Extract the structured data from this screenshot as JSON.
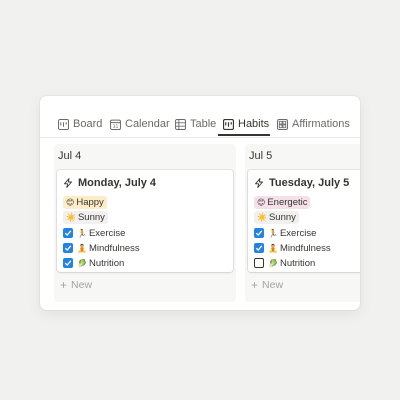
{
  "tabs": [
    {
      "label": "Board",
      "icon": "board-icon"
    },
    {
      "label": "Calendar",
      "icon": "calendar-icon"
    },
    {
      "label": "Table",
      "icon": "table-icon"
    },
    {
      "label": "Habits",
      "icon": "board-icon",
      "active": true
    },
    {
      "label": "Affirmations",
      "icon": "gallery-icon"
    }
  ],
  "columns": [
    {
      "header": "Jul 4",
      "card": {
        "title": "Monday, July 4",
        "mood": {
          "emoji": "😊",
          "label": "Happy",
          "color": "#fdecc8"
        },
        "weather": {
          "emoji": "☀️",
          "label": "Sunny",
          "color": "#f1f0ef"
        },
        "habits": [
          {
            "emoji": "🏃",
            "label": "Exercise",
            "checked": true
          },
          {
            "emoji": "🧘",
            "label": "Mindfulness",
            "checked": true
          },
          {
            "emoji": "🥬",
            "label": "Nutrition",
            "checked": true
          }
        ]
      },
      "new_label": "New"
    },
    {
      "header": "Jul 5",
      "card": {
        "title": "Tuesday, July 5",
        "mood": {
          "emoji": "😊",
          "label": "Energetic",
          "color": "#f5e0e9"
        },
        "weather": {
          "emoji": "☀️",
          "label": "Sunny",
          "color": "#f1f0ef"
        },
        "habits": [
          {
            "emoji": "🏃",
            "label": "Exercise",
            "checked": true
          },
          {
            "emoji": "🧘",
            "label": "Mindfulness",
            "checked": true
          },
          {
            "emoji": "🥬",
            "label": "Nutrition",
            "checked": false
          }
        ]
      },
      "new_label": "New"
    }
  ],
  "colors": {
    "accent_checkbox": "#2383e2",
    "text": "#37352f",
    "muted": "#6b6a66",
    "background": "#f1f1ef"
  }
}
